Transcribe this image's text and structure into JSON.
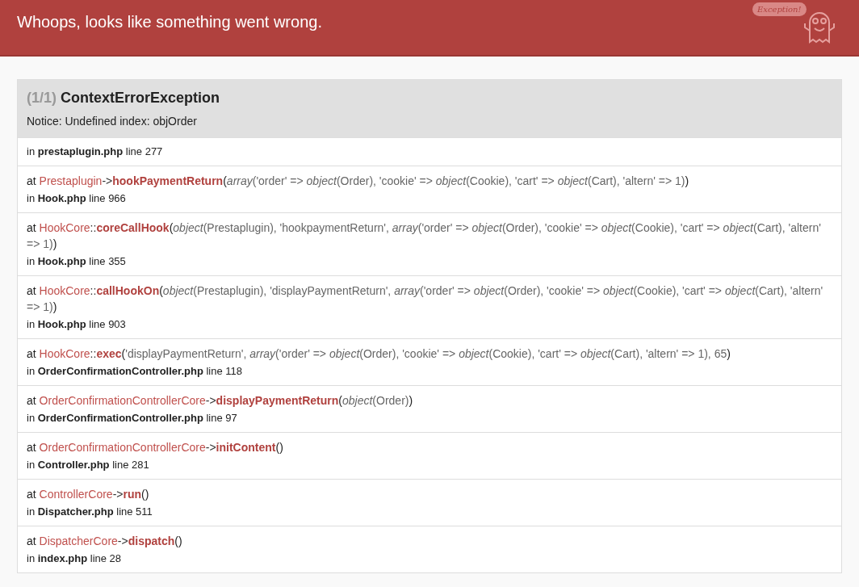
{
  "header": {
    "title": "Whoops, looks like something went wrong.",
    "logo_text": "Exception!"
  },
  "exception": {
    "counter": "(1/1)",
    "name": "ContextErrorException",
    "message": "Notice: Undefined index: objOrder"
  },
  "trace": [
    {
      "location": "in **prestaplugin.php** line 277"
    },
    {
      "at": "at",
      "class": "Prestaplugin",
      "operator": "->",
      "method": "hookPaymentReturn",
      "open": "(",
      "args": "*array*('order' => *object*(Order), 'cookie' => *object*(Cookie), 'cart' => *object*(Cart), 'altern' => 1)",
      "close": ")",
      "location": "in **Hook.php** line 966"
    },
    {
      "at": "at",
      "class": "HookCore",
      "operator": "::",
      "method": "coreCallHook",
      "open": "(",
      "args": "*object*(Prestaplugin), 'hookpaymentReturn', *array*('order' => *object*(Order), 'cookie' => *object*(Cookie), 'cart' => *object*(Cart), 'altern' => 1)",
      "close": ")",
      "location": "in **Hook.php** line 355"
    },
    {
      "at": "at",
      "class": "HookCore",
      "operator": "::",
      "method": "callHookOn",
      "open": "(",
      "args": "*object*(Prestaplugin), 'displayPaymentReturn', *array*('order' => *object*(Order), 'cookie' => *object*(Cookie), 'cart' => *object*(Cart), 'altern' => 1)",
      "close": ")",
      "location": "in **Hook.php** line 903"
    },
    {
      "at": "at",
      "class": "HookCore",
      "operator": "::",
      "method": "exec",
      "open": "(",
      "args": "'displayPaymentReturn', *array*('order' => *object*(Order), 'cookie' => *object*(Cookie), 'cart' => *object*(Cart), 'altern' => 1), 65",
      "close": ")",
      "location": "in **OrderConfirmationController.php** line 118"
    },
    {
      "at": "at",
      "class": "OrderConfirmationControllerCore",
      "operator": "->",
      "method": "displayPaymentReturn",
      "open": "(",
      "args": "*object*(Order)",
      "close": ")",
      "location": "in **OrderConfirmationController.php** line 97"
    },
    {
      "at": "at",
      "class": "OrderConfirmationControllerCore",
      "operator": "->",
      "method": "initContent",
      "open": "(",
      "close": ")",
      "location": "in **Controller.php** line 281"
    },
    {
      "at": "at",
      "class": "ControllerCore",
      "operator": "->",
      "method": "run",
      "open": "(",
      "close": ")",
      "location": "in **Dispatcher.php** line 511"
    },
    {
      "at": "at",
      "class": "DispatcherCore",
      "operator": "->",
      "method": "dispatch",
      "open": "(",
      "close": ")",
      "location": "in **index.php** line 28"
    }
  ]
}
